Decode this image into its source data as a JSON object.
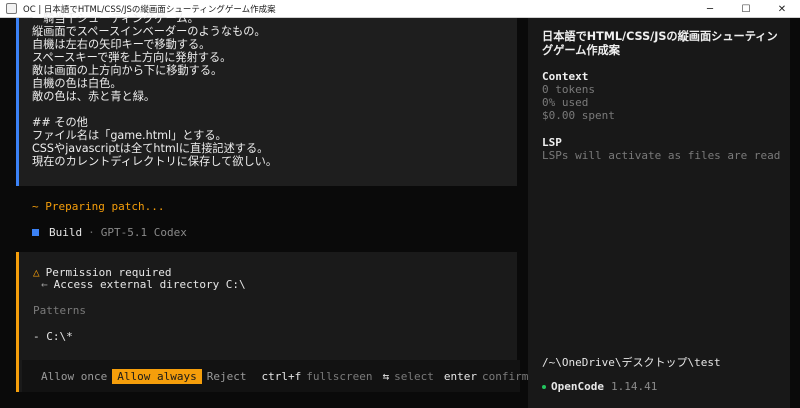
{
  "window": {
    "title": "OC | 日本語でHTML/CSS/JSの縦画面シューティングゲーム作成案",
    "controls": {
      "minimize": "─",
      "maximize": "☐",
      "close": "✕"
    }
  },
  "message": {
    "lines": [
      "一騎当千シューティングゲーム。",
      "縦画面でスペースインベーダーのようなもの。",
      "自機は左右の矢印キーで移動する。",
      "スペースキーで弾を上方向に発射する。",
      "敵は画面の上方向から下に移動する。",
      "自機の色は白色。",
      "敵の色は、赤と青と緑。",
      "",
      "## その他",
      "ファイル名は「game.html」とする。",
      "CSSやjavascriptは全てhtmlに直接記述する。",
      "現在のカレントディレクトリに保存して欲しい。"
    ]
  },
  "status": {
    "preparing": "~ Preparing patch..."
  },
  "build": {
    "label": "Build",
    "separator": "·",
    "model": "GPT-5.1 Codex",
    "icon_color": "#3b82f6"
  },
  "permission": {
    "warn_icon": "△",
    "title": "Permission required",
    "arrow_icon": "←",
    "subtitle": "Access external directory C:\\",
    "patterns_label": "Patterns",
    "pattern_item": "- C:\\*",
    "actions": {
      "allow_once": "Allow once",
      "allow_always": "Allow always",
      "reject": "Reject",
      "fullscreen_key": "ctrl+f",
      "fullscreen_label": "fullscreen",
      "select_icon": "⇆",
      "select_label": "select",
      "confirm_key": "enter",
      "confirm_label": "confirm"
    },
    "accent_color": "#f59e0b"
  },
  "sidebar": {
    "session_title": "日本語でHTML/CSS/JSの縦画面シューティングゲーム作成案",
    "context": {
      "heading": "Context",
      "tokens": "0 tokens",
      "used": "0% used",
      "spent": "$0.00 spent"
    },
    "lsp": {
      "heading": "LSP",
      "text": "LSPs will activate as files are read"
    },
    "path": "/~\\OneDrive\\デスクトップ\\test",
    "brand": {
      "name": "OpenCode",
      "version": "1.14.41",
      "dot_color": "#22c55e"
    }
  }
}
